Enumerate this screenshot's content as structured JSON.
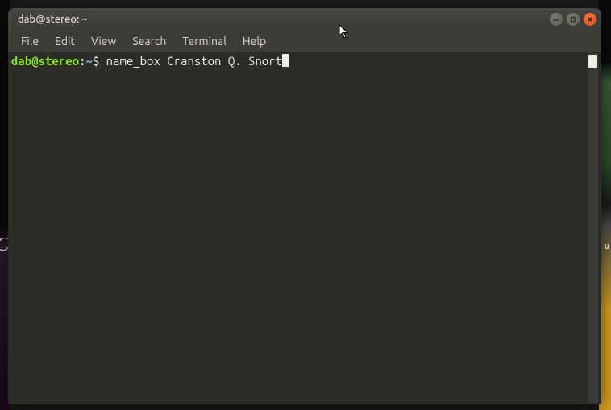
{
  "titlebar": {
    "title": "dab@stereo: ~"
  },
  "menubar": {
    "items": [
      "File",
      "Edit",
      "View",
      "Search",
      "Terminal",
      "Help"
    ]
  },
  "terminal": {
    "prompt": {
      "user_host": "dab@stereo",
      "colon": ":",
      "path": "~",
      "dollar": "$"
    },
    "command": "name_box Cranston Q. Snort"
  },
  "background": {
    "left_glyphs": "C\nC\nC",
    "right_label": "u"
  }
}
